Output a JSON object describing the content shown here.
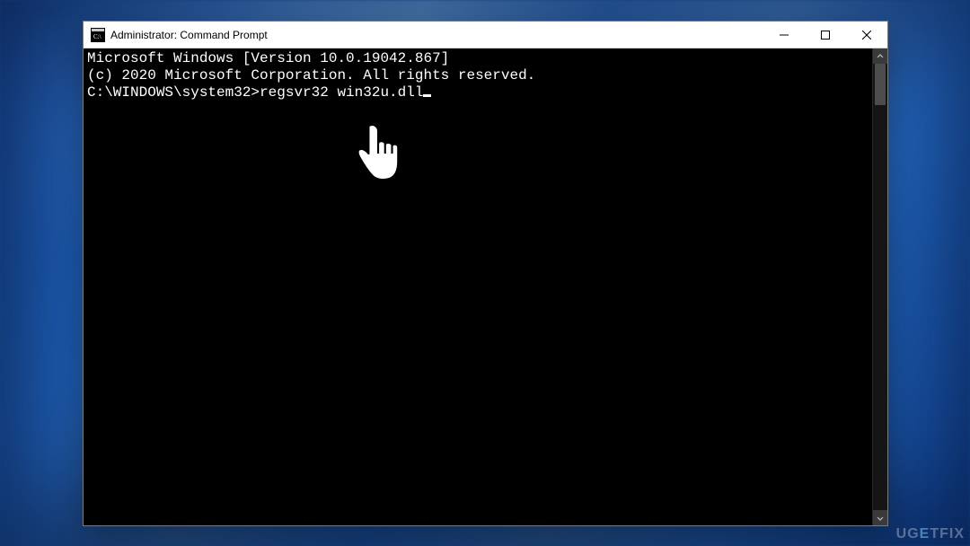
{
  "window": {
    "title": "Administrator: Command Prompt"
  },
  "console": {
    "line1": "Microsoft Windows [Version 10.0.19042.867]",
    "line2": "(c) 2020 Microsoft Corporation. All rights reserved.",
    "blank": "",
    "prompt": "C:\\WINDOWS\\system32>",
    "command": "regsvr32 win32u.dll"
  },
  "watermark": {
    "part1": "UG",
    "part2": "E",
    "part3": "TFIX"
  }
}
